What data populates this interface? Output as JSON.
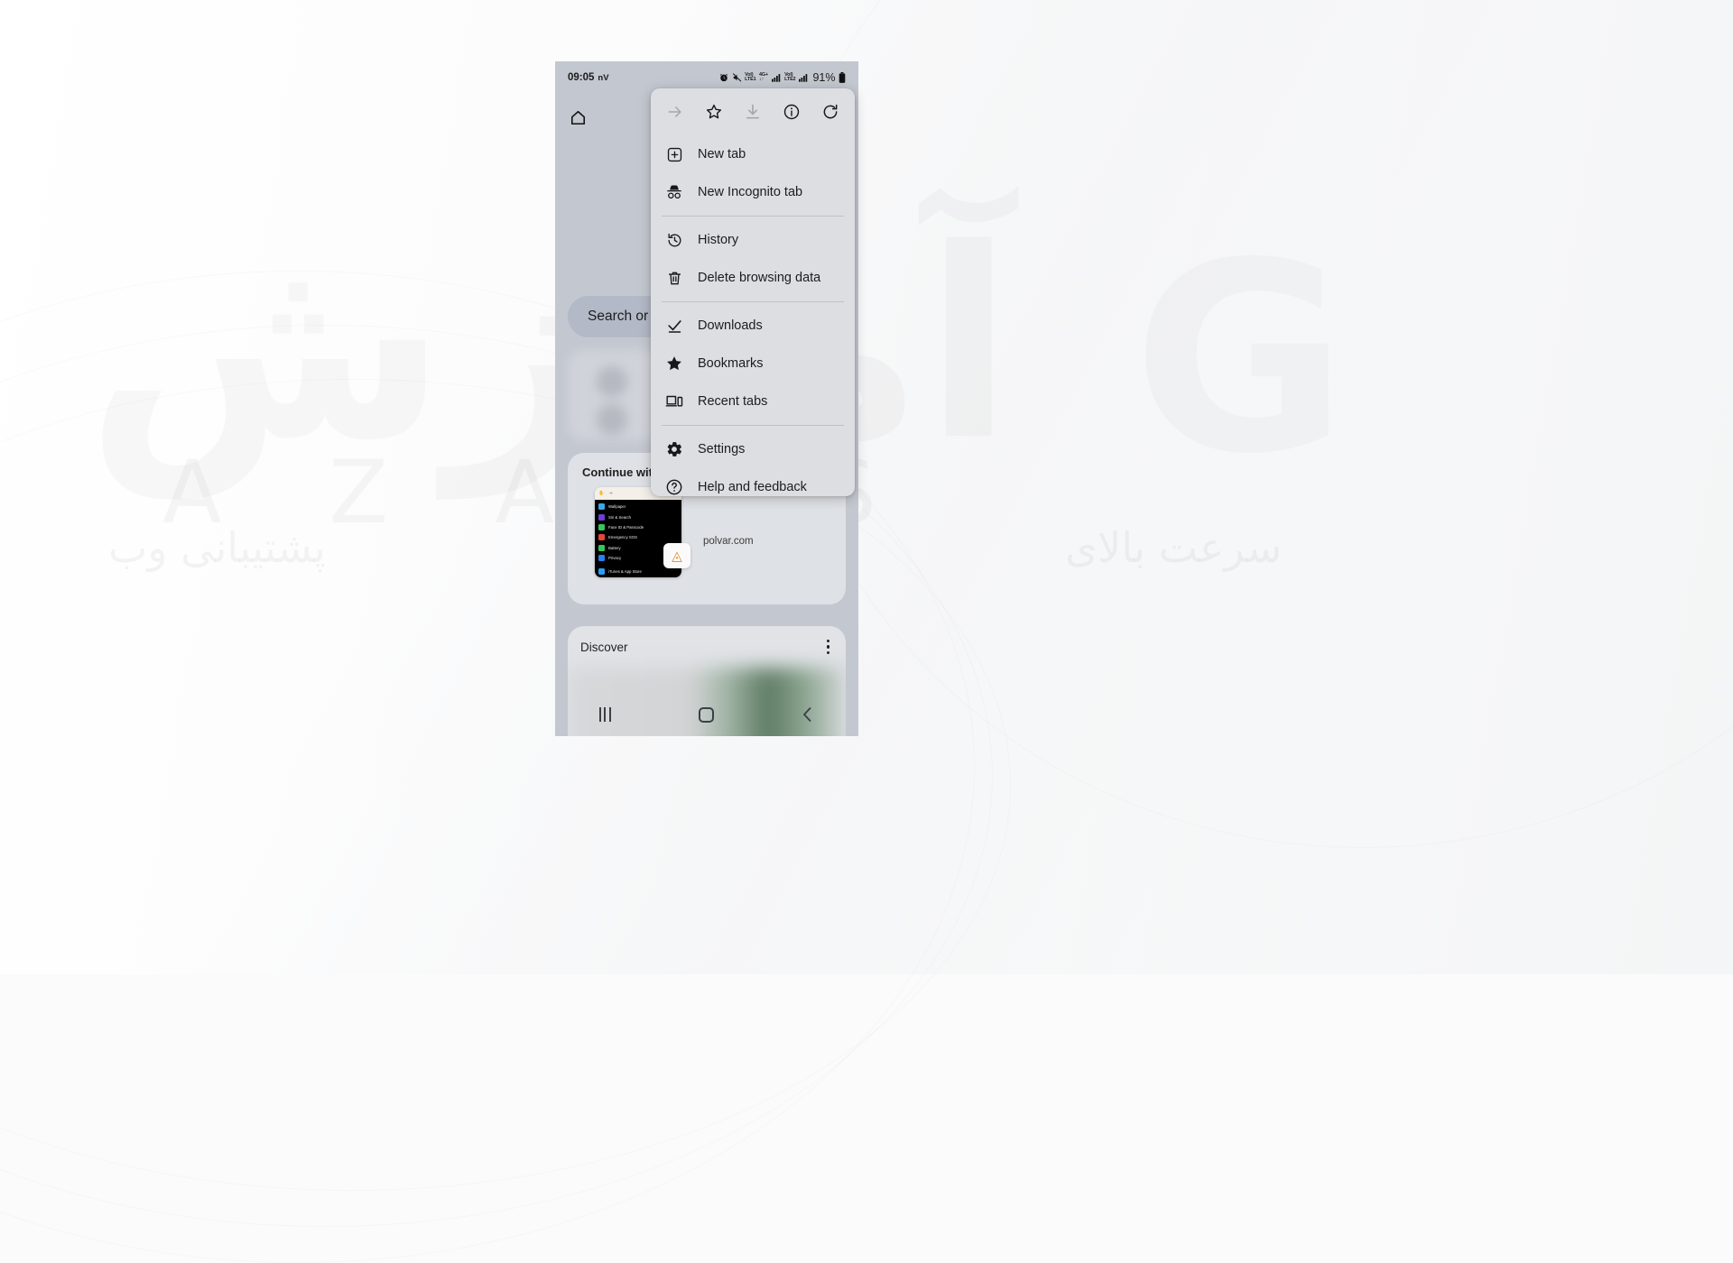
{
  "watermark": {
    "main": "آموزش",
    "latin": "A Z A Y S",
    "sub": "پشتیبانی وب",
    "right": "سرعت بالای",
    "glyph": "G"
  },
  "phone": {
    "status_bar": {
      "time": "09:05",
      "carrier": "nV",
      "battery_percent": "91%",
      "icons": [
        {
          "name": "alarm-icon",
          "label": "alarm"
        },
        {
          "name": "mute-icon",
          "label": "mute"
        },
        {
          "name": "volte1-icon",
          "label_top": "VoI)",
          "label_bottom": "LTE1"
        },
        {
          "name": "network-4gplus-icon",
          "label_top": "4G+",
          "label_bottom": "↓↑"
        },
        {
          "name": "signal-bars-1-icon",
          "label": "signal"
        },
        {
          "name": "volte2-icon",
          "label_top": "VoI)",
          "label_bottom": "LTE2"
        },
        {
          "name": "signal-bars-2-icon",
          "label": "signal"
        },
        {
          "name": "battery-icon",
          "label": "battery"
        }
      ]
    },
    "toolbar": {
      "home_label": "Home"
    },
    "new_tab_page": {
      "search_box_placeholder": "Search or",
      "continue_card": {
        "title": "Continue with",
        "url": "polvar.com",
        "thumbnail_rows": [
          {
            "label": "Wallpaper",
            "color": "#3aa7e8"
          },
          {
            "label": "Siri & Search",
            "color": "#6b3fd4"
          },
          {
            "label": "Face ID & Passcode",
            "color": "#34c759"
          },
          {
            "label": "Emergency SOS",
            "color": "#e8453c"
          },
          {
            "label": "Battery",
            "color": "#34c759"
          },
          {
            "label": "Privacy",
            "color": "#2a7ef0"
          },
          {
            "label": "iTunes & App Store",
            "color": "#2a9df4"
          }
        ]
      },
      "discover": {
        "title": "Discover",
        "menu_label": "More"
      }
    },
    "nav_bar": {
      "recents_label": "Recents",
      "home_label": "Home",
      "back_label": "Back"
    }
  },
  "overflow_menu": {
    "header_actions": [
      {
        "name": "forward-arrow-icon",
        "label": "Forward",
        "disabled": true
      },
      {
        "name": "star-outline-icon",
        "label": "Bookmark this page",
        "disabled": false
      },
      {
        "name": "download-icon",
        "label": "Download page",
        "disabled": true
      },
      {
        "name": "info-circle-icon",
        "label": "Page info",
        "disabled": false
      },
      {
        "name": "reload-icon",
        "label": "Reload",
        "disabled": false
      }
    ],
    "items": [
      {
        "label": "New tab",
        "icon": "new-tab-icon"
      },
      {
        "label": "New Incognito tab",
        "icon": "incognito-icon"
      },
      {
        "label": "History",
        "icon": "history-icon"
      },
      {
        "label": "Delete browsing data",
        "icon": "trash-icon"
      },
      {
        "label": "Downloads",
        "icon": "downloads-check-icon"
      },
      {
        "label": "Bookmarks",
        "icon": "star-filled-icon"
      },
      {
        "label": "Recent tabs",
        "icon": "recent-tabs-icon"
      },
      {
        "label": "Settings",
        "icon": "gear-icon"
      },
      {
        "label": "Help and feedback",
        "icon": "help-circle-icon"
      }
    ]
  },
  "colors": {
    "phone_bg": "#c3c7cf",
    "menu_bg": "#dcdee2",
    "search_bar": "#b3b9c6",
    "text_primary": "#1c1c1e"
  }
}
